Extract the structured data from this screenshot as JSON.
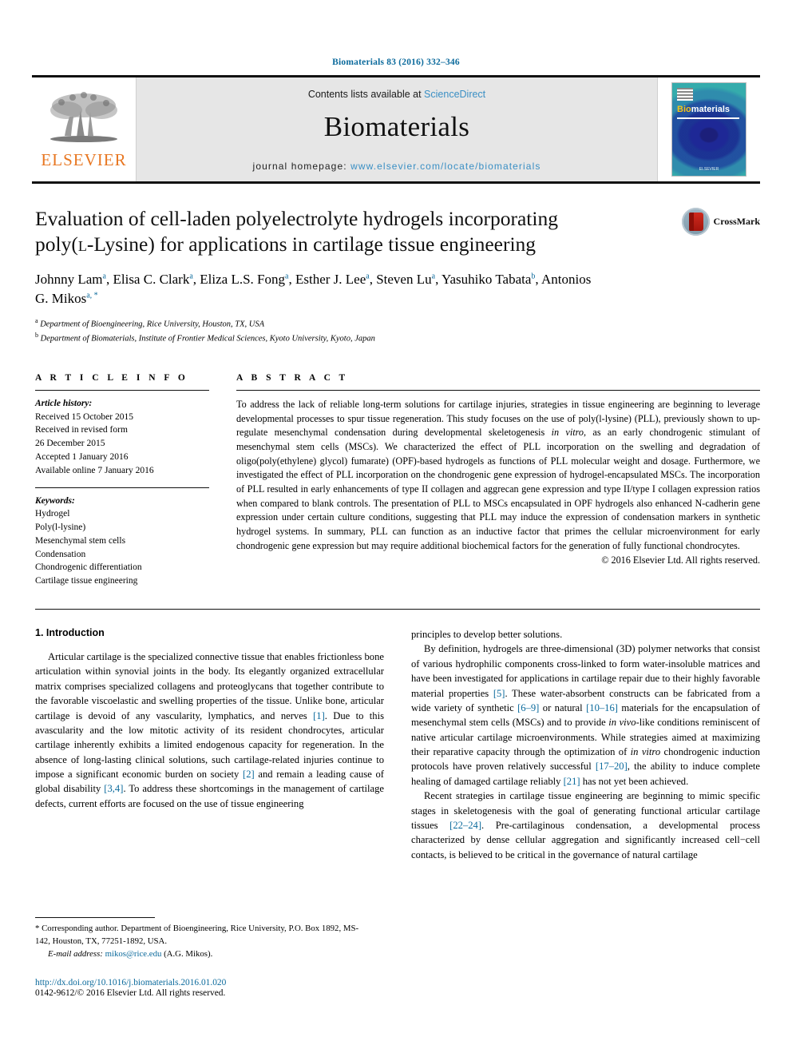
{
  "running_head": "Biomaterials 83 (2016) 332–346",
  "masthead": {
    "contents_prefix": "Contents lists available at ",
    "contents_link": "ScienceDirect",
    "journal_title": "Biomaterials",
    "homepage_prefix": "journal homepage: ",
    "homepage_url": "www.elsevier.com/locate/biomaterials",
    "publisher_logo_text": "ELSEVIER",
    "cover_title_bio": "Bio",
    "cover_title_rest": "materials",
    "cover_footer": "ELSEVIER"
  },
  "article": {
    "title_line1": "Evaluation of cell-laden polyelectrolyte hydrogels incorporating",
    "title_line2_a": "poly(",
    "title_line2_sc": "l",
    "title_line2_b": "-Lysine) for applications in cartilage tissue engineering",
    "crossmark_label": "CrossMark",
    "authors": [
      {
        "name": "Johnny Lam",
        "sup": "a",
        "sep": ", "
      },
      {
        "name": "Elisa C. Clark",
        "sup": "a",
        "sep": ", "
      },
      {
        "name": "Eliza L.S. Fong",
        "sup": "a",
        "sep": ", "
      },
      {
        "name": "Esther J. Lee",
        "sup": "a",
        "sep": ", "
      },
      {
        "name": "Steven Lu",
        "sup": "a",
        "sep": ", "
      },
      {
        "name": "Yasuhiko Tabata",
        "sup": "b",
        "sep": ", "
      },
      {
        "name": "Antonios G. Mikos",
        "sup": "a, *",
        "sep": ""
      }
    ],
    "affiliations": [
      {
        "mark": "a",
        "text": "Department of Bioengineering, Rice University, Houston, TX, USA"
      },
      {
        "mark": "b",
        "text": "Department of Biomaterials, Institute of Frontier Medical Sciences, Kyoto University, Kyoto, Japan"
      }
    ]
  },
  "article_info": {
    "heading": "A R T I C L E   I N F O",
    "history_label": "Article history:",
    "history": [
      "Received 15 October 2015",
      "Received in revised form",
      "26 December 2015",
      "Accepted 1 January 2016",
      "Available online 7 January 2016"
    ],
    "keywords_label": "Keywords:",
    "keywords": [
      "Hydrogel",
      "Poly(l-lysine)",
      "Mesenchymal stem cells",
      "Condensation",
      "Chondrogenic differentiation",
      "Cartilage tissue engineering"
    ]
  },
  "abstract": {
    "heading": "A B S T R A C T",
    "body_1": "To address the lack of reliable long-term solutions for cartilage injuries, strategies in tissue engineering are beginning to leverage developmental processes to spur tissue regeneration. This study focuses on the use of poly(l-lysine) (PLL), previously shown to up-regulate mesenchymal condensation during developmental skeletogenesis ",
    "italic_1": "in vitro",
    "body_2": ", as an early chondrogenic stimulant of mesenchymal stem cells (MSCs). We characterized the effect of PLL incorporation on the swelling and degradation of oligo(poly(ethylene) glycol) fumarate) (OPF)-based hydrogels as functions of PLL molecular weight and dosage. Furthermore, we investigated the effect of PLL incorporation on the chondrogenic gene expression of hydrogel-encapsulated MSCs. The incorporation of PLL resulted in early enhancements of type II collagen and aggrecan gene expression and type II/type I collagen expression ratios when compared to blank controls. The presentation of PLL to MSCs encapsulated in OPF hydrogels also enhanced N-cadherin gene expression under certain culture conditions, suggesting that PLL may induce the expression of condensation markers in synthetic hydrogel systems. In summary, PLL can function as an inductive factor that primes the cellular microenvironment for early chondrogenic gene expression but may require additional biochemical factors for the generation of fully functional chondrocytes.",
    "copyright": "© 2016 Elsevier Ltd. All rights reserved."
  },
  "introduction": {
    "section_title": "1. Introduction",
    "left_paragraphs": [
      {
        "segments": [
          {
            "t": "Articular cartilage is the specialized connective tissue that enables frictionless bone articulation within synovial joints in the body. Its elegantly organized extracellular matrix comprises specialized collagens and proteoglycans that together contribute to the favorable viscoelastic and swelling properties of the tissue. Unlike bone, articular cartilage is devoid of any vascularity, lymphatics, and nerves "
          },
          {
            "t": "[1]",
            "k": "ref"
          },
          {
            "t": ". Due to this avascularity and the low mitotic activity of its resident chondrocytes, articular cartilage inherently exhibits a limited endogenous capacity for regeneration. In the absence of long-lasting clinical solutions, such cartilage-related injuries continue to impose a significant economic burden on society "
          },
          {
            "t": "[2]",
            "k": "ref"
          },
          {
            "t": " and remain a leading cause of global disability "
          },
          {
            "t": "[3,4]",
            "k": "ref"
          },
          {
            "t": ". To address these shortcomings in the management of cartilage defects, current efforts are focused on the use of tissue engineering"
          }
        ]
      }
    ],
    "right_paragraphs": [
      {
        "indent": false,
        "segments": [
          {
            "t": "principles to develop better solutions."
          }
        ]
      },
      {
        "indent": true,
        "segments": [
          {
            "t": "By definition, hydrogels are three-dimensional (3D) polymer networks that consist of various hydrophilic components cross-linked to form water-insoluble matrices and have been investigated for applications in cartilage repair due to their highly favorable material properties "
          },
          {
            "t": "[5]",
            "k": "ref"
          },
          {
            "t": ". These water-absorbent constructs can be fabricated from a wide variety of synthetic "
          },
          {
            "t": "[6–9]",
            "k": "ref"
          },
          {
            "t": " or natural "
          },
          {
            "t": "[10–16]",
            "k": "ref"
          },
          {
            "t": " materials for the encapsulation of mesenchymal stem cells (MSCs) and to provide "
          },
          {
            "t": "in vivo",
            "k": "i"
          },
          {
            "t": "-like conditions reminiscent of native articular cartilage microenvironments. While strategies aimed at maximizing their reparative capacity through the optimization of "
          },
          {
            "t": "in vitro",
            "k": "i"
          },
          {
            "t": " chondrogenic induction protocols have proven relatively successful "
          },
          {
            "t": "[17–20]",
            "k": "ref"
          },
          {
            "t": ", the ability to induce complete healing of damaged cartilage reliably "
          },
          {
            "t": "[21]",
            "k": "ref"
          },
          {
            "t": " has not yet been achieved."
          }
        ]
      },
      {
        "indent": true,
        "segments": [
          {
            "t": "Recent strategies in cartilage tissue engineering are beginning to mimic specific stages in skeletogenesis with the goal of generating functional articular cartilage tissues "
          },
          {
            "t": "[22–24]",
            "k": "ref"
          },
          {
            "t": ". Pre-cartilaginous condensation, a developmental process characterized by dense cellular aggregation and significantly increased cell−cell contacts, is believed to be critical in the governance of natural cartilage"
          }
        ]
      }
    ]
  },
  "footer": {
    "corresponding_star": "*",
    "corresponding_text": " Corresponding author. Department of Bioengineering, Rice University, P.O. Box 1892, MS-142, Houston, TX, 77251-1892, USA.",
    "email_label": "E-mail address:",
    "email": "mikos@rice.edu",
    "email_suffix": " (A.G. Mikos).",
    "doi": "http://dx.doi.org/10.1016/j.biomaterials.2016.01.020",
    "issn": "0142-9612/© 2016 Elsevier Ltd. All rights reserved."
  },
  "colors": {
    "link": "#0b6a9c",
    "elsevier_orange": "#e87722",
    "masthead_bg": "#e6e6e6"
  }
}
